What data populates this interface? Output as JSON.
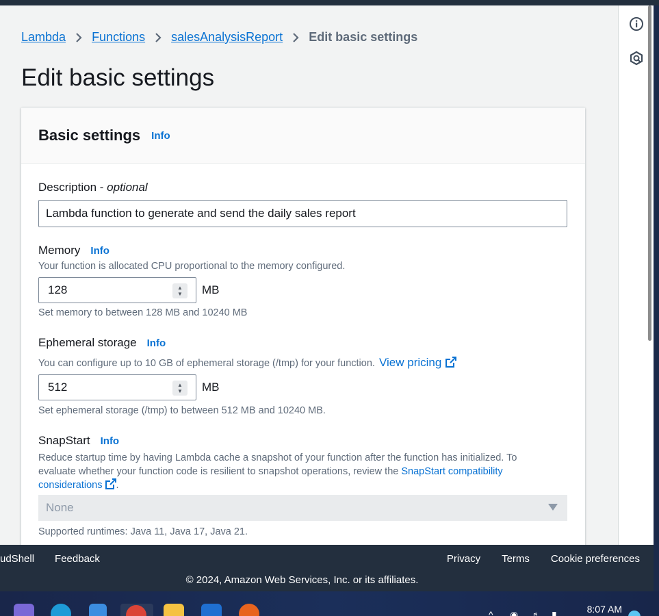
{
  "breadcrumb": {
    "items": [
      "Lambda",
      "Functions",
      "salesAnalysisReport"
    ],
    "current": "Edit basic settings"
  },
  "page": {
    "title": "Edit basic settings"
  },
  "card": {
    "title": "Basic settings",
    "info": "Info"
  },
  "description": {
    "label": "Description",
    "label_suffix": " - ",
    "optional": "optional",
    "value": "Lambda function to generate and send the daily sales report"
  },
  "memory": {
    "label": "Memory",
    "info": "Info",
    "help": "Your function is allocated CPU proportional to the memory configured.",
    "value": "128",
    "unit": "MB",
    "constraint": "Set memory to between 128 MB and 10240 MB"
  },
  "ephemeral": {
    "label": "Ephemeral storage",
    "info": "Info",
    "help": "You can configure up to 10 GB of ephemeral storage (/tmp) for your function.",
    "pricing_link": "View pricing",
    "value": "512",
    "unit": "MB",
    "constraint": "Set ephemeral storage (/tmp) to between 512 MB and 10240 MB."
  },
  "snapstart": {
    "label": "SnapStart",
    "info": "Info",
    "help_line1": "Reduce startup time by having Lambda cache a snapshot of your function after the function has initialized. To",
    "help_line2": "evaluate whether your function code is resilient to snapshot operations, review the",
    "compat_link_a": "SnapStart compatibility",
    "compat_link_b": "considerations",
    "period": ".",
    "selected": "None",
    "runtimes": "Supported runtimes: Java 11, Java 17, Java 21."
  },
  "footer": {
    "cloudshell": "udShell",
    "feedback": "Feedback",
    "privacy": "Privacy",
    "terms": "Terms",
    "cookies": "Cookie preferences",
    "copyright": "© 2024, Amazon Web Services, Inc. or its affiliates."
  },
  "taskbar": {
    "time": "8:07 AM"
  },
  "colors": {
    "link": "#0972d3",
    "footer_bg": "#232f3e",
    "page_bg": "#f2f3f3"
  }
}
